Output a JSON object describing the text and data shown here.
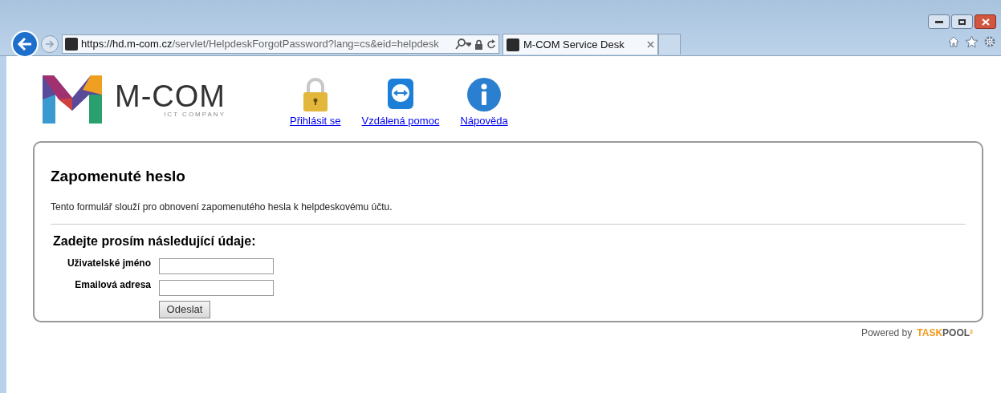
{
  "browser": {
    "url": {
      "scheme": "https://",
      "host": "hd.m-com.cz",
      "path": "/servlet/HelpdeskForgotPassword?lang=cs&eid=helpdesk"
    },
    "tabs": [
      {
        "title": "M-COM Service Desk",
        "selected": true
      }
    ]
  },
  "header": {
    "logo": {
      "name": "M-COM",
      "tagline": "ICT COMPANY"
    },
    "links": [
      {
        "kind": "lock",
        "label": "Přihlásit se"
      },
      {
        "kind": "remote",
        "label": "Vzdálená pomoc"
      },
      {
        "kind": "info",
        "label": "Nápověda"
      }
    ]
  },
  "form": {
    "title": "Zapomenuté heslo",
    "description": "Tento formulář slouží pro obnovení zapomenutého hesla k helpdeskovému účtu.",
    "subtitle": "Zadejte prosím následující údaje:",
    "fields": [
      {
        "label": "Uživatelské jméno"
      },
      {
        "label": "Emailová adresa"
      }
    ],
    "submit": "Odeslat"
  },
  "footer": {
    "powered_by": "Powered by",
    "brand_main": "TASK",
    "brand_rest": "POOL",
    "brand_sup": "3"
  }
}
